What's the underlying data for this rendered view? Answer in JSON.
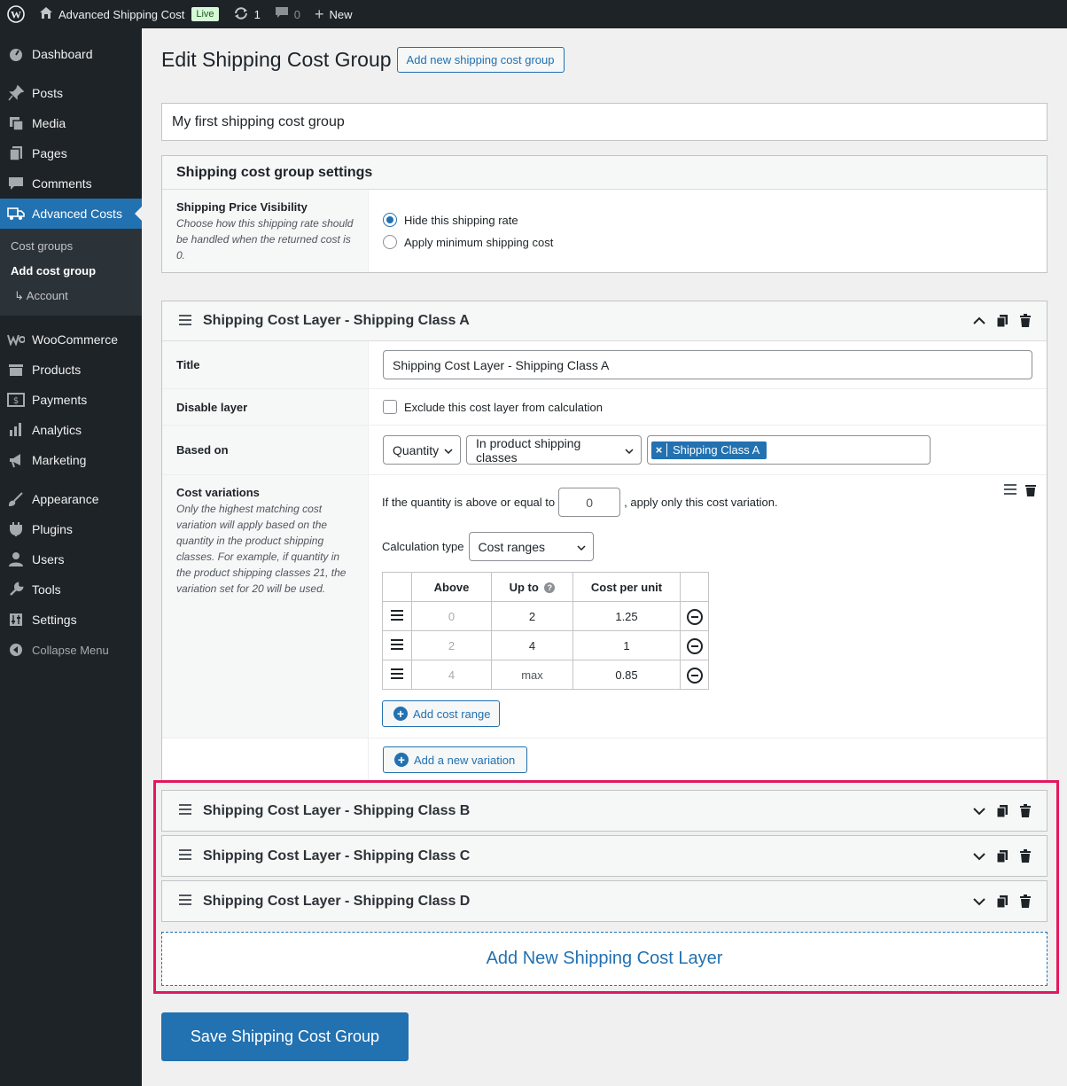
{
  "adminbar": {
    "site_name": "Advanced Shipping Cost",
    "live_badge": "Live",
    "updates_count": "1",
    "comments_count": "0",
    "new_label": "New"
  },
  "sidebar": {
    "items_top": [
      {
        "label": "Dashboard",
        "icon": "dashboard-icon"
      },
      {
        "label": "Posts",
        "icon": "pin-icon"
      },
      {
        "label": "Media",
        "icon": "media-icon"
      },
      {
        "label": "Pages",
        "icon": "pages-icon"
      },
      {
        "label": "Comments",
        "icon": "comments-icon"
      },
      {
        "label": "Advanced Costs",
        "icon": "truck-icon"
      }
    ],
    "submenu": [
      "Cost groups",
      "Add cost group",
      "↳ Account"
    ],
    "items_bottom": [
      {
        "label": "WooCommerce",
        "icon": "woo-icon"
      },
      {
        "label": "Products",
        "icon": "products-icon"
      },
      {
        "label": "Payments",
        "icon": "payments-icon"
      },
      {
        "label": "Analytics",
        "icon": "analytics-icon"
      },
      {
        "label": "Marketing",
        "icon": "marketing-icon"
      },
      {
        "label": "Appearance",
        "icon": "appearance-icon"
      },
      {
        "label": "Plugins",
        "icon": "plugins-icon"
      },
      {
        "label": "Users",
        "icon": "users-icon"
      },
      {
        "label": "Tools",
        "icon": "tools-icon"
      },
      {
        "label": "Settings",
        "icon": "settings-icon"
      }
    ],
    "collapse": "Collapse Menu"
  },
  "page": {
    "title": "Edit Shipping Cost Group",
    "add_new_button": "Add new shipping cost group",
    "group_name": "My first shipping cost group"
  },
  "settings": {
    "heading": "Shipping cost group settings",
    "visibility_label": "Shipping Price Visibility",
    "visibility_desc": "Choose how this shipping rate should be handled when the returned cost is 0.",
    "option_hide": "Hide this shipping rate",
    "option_min": "Apply minimum shipping cost"
  },
  "layer_a": {
    "title": "Shipping Cost Layer - Shipping Class A",
    "title_label": "Title",
    "title_value": "Shipping Cost Layer - Shipping Class A",
    "disable_label": "Disable layer",
    "disable_text": "Exclude this cost layer from calculation",
    "based_label": "Based on",
    "based_select1": "Quantity",
    "based_select2": "In product shipping classes",
    "chip_remove": "×",
    "chip": "Shipping Class A",
    "variations_label": "Cost variations",
    "variations_desc": "Only the highest matching cost variation will apply based on the quantity in the product shipping classes. For example, if quantity in the product shipping classes 21, the variation set for 20 will be used.",
    "condition_prefix": "If the quantity is above or equal to",
    "condition_value": "0",
    "condition_suffix": ", apply only this cost variation.",
    "calc_label": "Calculation type",
    "calc_value": "Cost ranges",
    "table_headers": [
      "Above",
      "Up to",
      "Cost per unit"
    ],
    "rows": [
      {
        "above": "0",
        "upto": "2",
        "cost": "1.25"
      },
      {
        "above": "2",
        "upto": "4",
        "cost": "1"
      },
      {
        "above": "4",
        "upto": "max",
        "cost": "0.85"
      }
    ],
    "add_range": "Add cost range",
    "add_variation": "Add a new variation"
  },
  "collapsed_layers": [
    "Shipping Cost Layer - Shipping Class B",
    "Shipping Cost Layer - Shipping Class C",
    "Shipping Cost Layer - Shipping Class D"
  ],
  "add_layer": "Add New Shipping Cost Layer",
  "save_button": "Save Shipping Cost Group",
  "colors": {
    "accent": "#2271b1",
    "highlight": "#e3175f",
    "adminbar": "#1d2327"
  }
}
